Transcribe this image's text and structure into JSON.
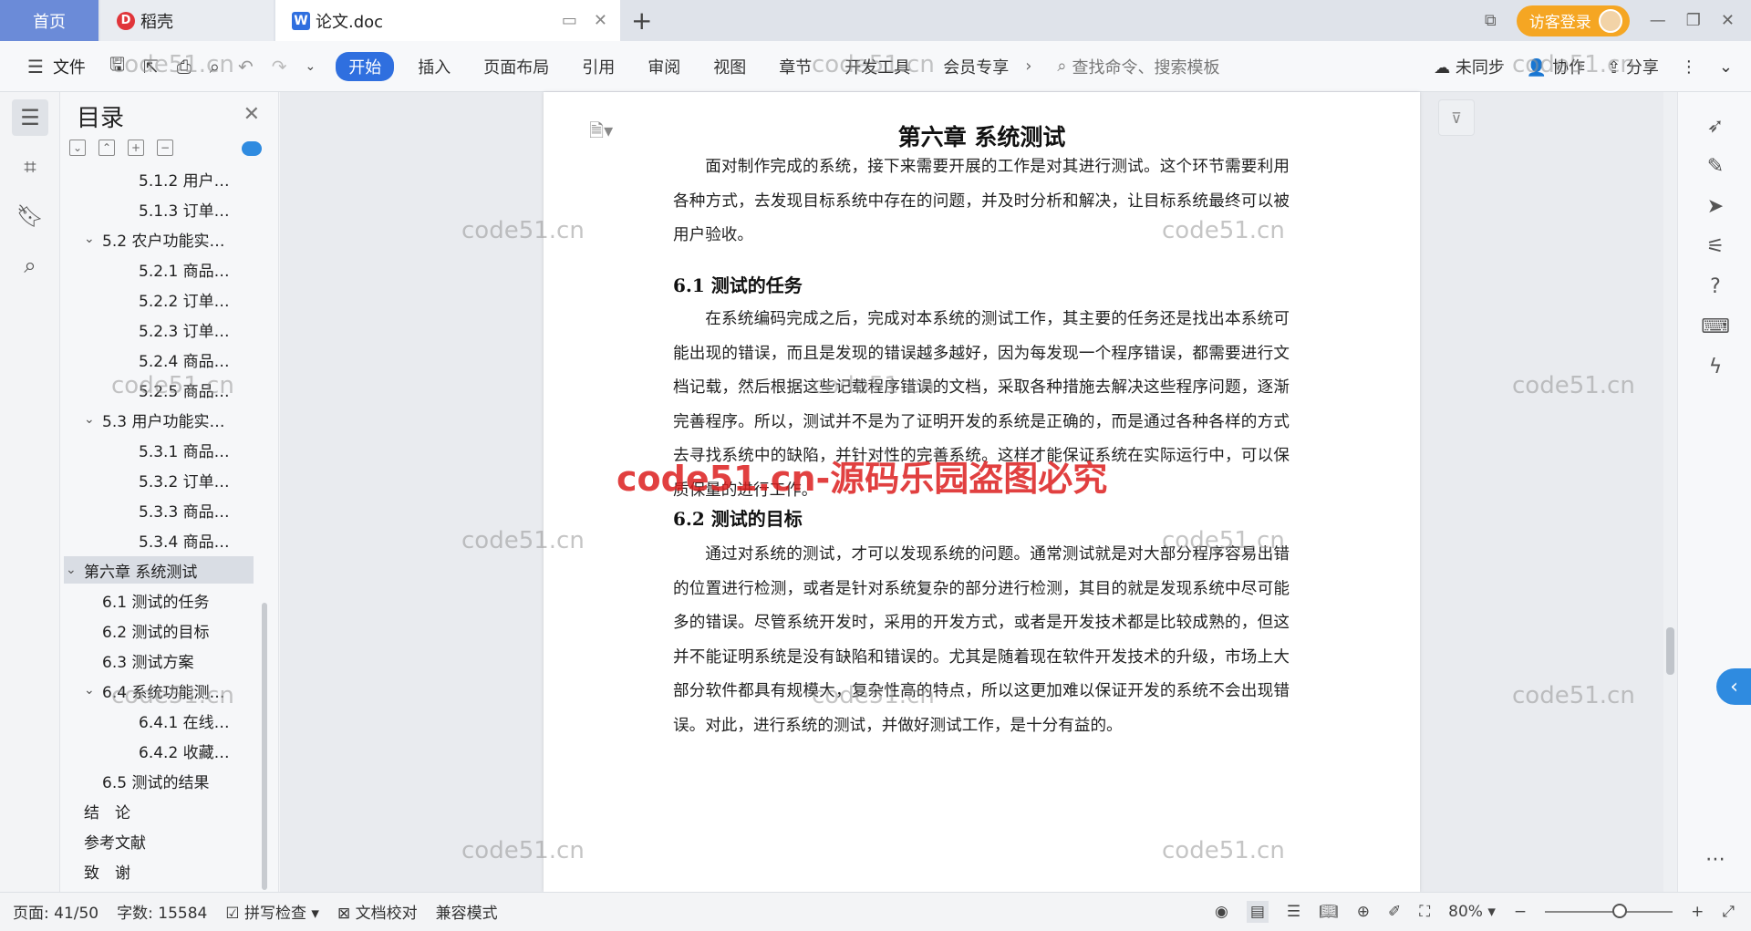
{
  "titlebar": {
    "tab_home": "首页",
    "tab_daoke": "稻壳",
    "tab_doc": "论文.doc",
    "login": "访客登录"
  },
  "toolbar": {
    "file": "文件",
    "menus": [
      "开始",
      "插入",
      "页面布局",
      "引用",
      "审阅",
      "视图",
      "章节",
      "开发工具",
      "会员专享"
    ],
    "search_placeholder": "查找命令、搜索模板",
    "sync": "未同步",
    "collab": "协作",
    "share": "分享"
  },
  "toc": {
    "title": "目录",
    "items": [
      {
        "label": "5.1.2 用户…",
        "level": 3,
        "arrow": ""
      },
      {
        "label": "5.1.3 订单…",
        "level": 3,
        "arrow": ""
      },
      {
        "label": "5.2 农户功能实…",
        "level": 2,
        "arrow": "v"
      },
      {
        "label": "5.2.1 商品…",
        "level": 3,
        "arrow": ""
      },
      {
        "label": "5.2.2 订单…",
        "level": 3,
        "arrow": ""
      },
      {
        "label": "5.2.3 订单…",
        "level": 3,
        "arrow": ""
      },
      {
        "label": "5.2.4 商品…",
        "level": 3,
        "arrow": ""
      },
      {
        "label": "5.2.5 商品…",
        "level": 3,
        "arrow": ""
      },
      {
        "label": "5.3 用户功能实…",
        "level": 2,
        "arrow": "v"
      },
      {
        "label": "5.3.1 商品…",
        "level": 3,
        "arrow": ""
      },
      {
        "label": "5.3.2 订单…",
        "level": 3,
        "arrow": ""
      },
      {
        "label": "5.3.3 商品…",
        "level": 3,
        "arrow": ""
      },
      {
        "label": "5.3.4 商品…",
        "level": 3,
        "arrow": ""
      },
      {
        "label": "第六章 系统测试",
        "level": 1,
        "arrow": "v",
        "selected": true
      },
      {
        "label": "6.1 测试的任务",
        "level": 2,
        "arrow": ""
      },
      {
        "label": "6.2 测试的目标",
        "level": 2,
        "arrow": ""
      },
      {
        "label": "6.3 测试方案",
        "level": 2,
        "arrow": ""
      },
      {
        "label": "6.4 系统功能测…",
        "level": 2,
        "arrow": "v"
      },
      {
        "label": "6.4.1 在线…",
        "level": 3,
        "arrow": ""
      },
      {
        "label": "6.4.2 收藏…",
        "level": 3,
        "arrow": ""
      },
      {
        "label": "6.5 测试的结果",
        "level": 2,
        "arrow": ""
      },
      {
        "label": "结　论",
        "level": 1,
        "arrow": ""
      },
      {
        "label": "参考文献",
        "level": 1,
        "arrow": ""
      },
      {
        "label": "致　谢",
        "level": 1,
        "arrow": ""
      }
    ]
  },
  "document": {
    "chapter_title": "第六章 系统测试",
    "intro": "面对制作完成的系统，接下来需要开展的工作是对其进行测试。这个环节需要利用各种方式，去发现目标系统中存在的问题，并及时分析和解决，让目标系统最终可以被用户验收。",
    "sec1_title": "6.1 测试的任务",
    "sec1_body": "在系统编码完成之后，完成对本系统的测试工作，其主要的任务还是找出本系统可能出现的错误，而且是发现的错误越多越好，因为每发现一个程序错误，都需要进行文档记载，然后根据这些记载程序错误的文档，采取各种措施去解决这些程序问题，逐渐完善程序。所以，测试并不是为了证明开发的系统是正确的，而是通过各种各样的方式去寻找系统中的缺陷，并针对性的完善系统。这样才能保证系统在实际运行中，可以保质保量的进行工作。",
    "sec2_title": "6.2 测试的目标",
    "sec2_body": "通过对系统的测试，才可以发现系统的问题。通常测试就是对大部分程序容易出错的位置进行检测，或者是针对系统复杂的部分进行检测，其目的就是发现系统中尽可能多的错误。尽管系统开发时，采用的开发方式，或者是开发技术都是比较成熟的，但这并不能证明系统是没有缺陷和错误的。尤其是随着现在软件开发技术的升级，市场上大部分软件都具有规模大，复杂性高的特点，所以这更加难以保证开发的系统不会出现错误。对此，进行系统的测试，并做好测试工作，是十分有益的。"
  },
  "statusbar": {
    "page": "页面: 41/50",
    "words": "字数: 15584",
    "spell": "拼写检查",
    "proof": "文档校对",
    "compat": "兼容模式",
    "zoom": "80%",
    "zoom_level": 0.8
  },
  "watermarks": {
    "small": "code51.cn",
    "main": "code51.cn-源码乐园盗图必究"
  },
  "colors": {
    "accent": "#2f6fdf",
    "home_tab": "#6b8bd8",
    "login": "#f5a623",
    "toc_selected": "#d9dde4",
    "watermark_main": "#dc1e1e"
  }
}
